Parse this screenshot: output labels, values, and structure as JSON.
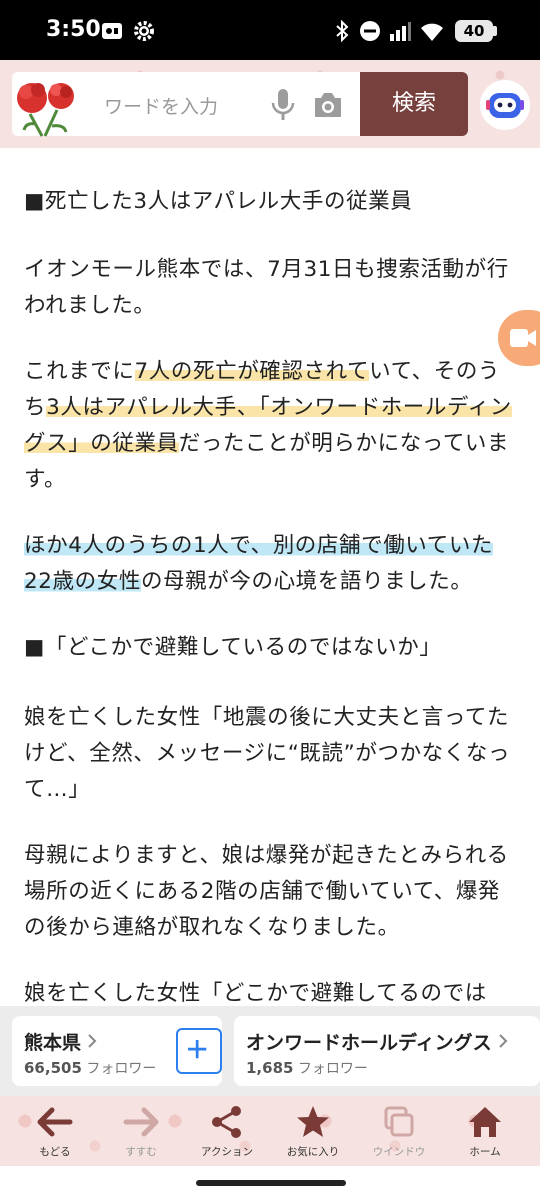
{
  "status_bar": {
    "time": "3:50",
    "battery": "40",
    "icons": [
      "screen-record-icon",
      "settings-gear-icon",
      "bluetooth-icon",
      "do-not-disturb-icon",
      "signal-icon",
      "wifi-icon",
      "battery-icon"
    ]
  },
  "header": {
    "search_placeholder": "ワードを入力",
    "search_button": "検索",
    "icons": [
      "carnation-flower-logo",
      "mic-icon",
      "camera-icon",
      "assistant-bot-icon"
    ]
  },
  "article": {
    "paragraphs": [
      [
        "■死亡した3人はアパレル大手の従業員"
      ],
      [
        "イオンモール熊本では、7月31日も捜索活動が行われました。"
      ],
      [
        "これまでに",
        "7人の死亡が確認されて",
        "いて、そのうち",
        "3人はアパレル大手、「オンワードホールディングス」の従業員",
        "だったことが明らかになっています。"
      ],
      [
        "ほか4人のうちの1人で、別の店舗で働いていた22歳の女性",
        "の母親が今の心境を語りました。"
      ],
      [
        "■「どこかで避難しているのではないか」"
      ],
      [
        "娘を亡くした女性「地震の後に大丈夫と言ってたけど、全然、メッセージに“既読”がつかなくなって…」"
      ],
      [
        "母親によりますと、娘は爆発が起きたとみられる場所の近くにある2階の店舗で働いていて、爆発の後から連絡が取れなくなりました。"
      ],
      [
        "娘を亡くした女性「どこかで避難してるのでは"
      ]
    ],
    "highlight_color_yellow": "#fbe4a8",
    "highlight_color_blue": "#bfe7f6"
  },
  "follow": [
    {
      "name": "熊本県",
      "count": "66,505",
      "unit": "フォロワー"
    },
    {
      "name": "オンワードホールディングス",
      "count": "1,685",
      "unit": "フォロワー"
    }
  ],
  "nav": [
    {
      "label": "もどる",
      "icon": "back-arrow-icon"
    },
    {
      "label": "すすむ",
      "icon": "forward-arrow-icon"
    },
    {
      "label": "アクション",
      "icon": "share-icon"
    },
    {
      "label": "お気に入り",
      "icon": "star-icon"
    },
    {
      "label": "ウインドウ",
      "icon": "window-icon"
    },
    {
      "label": "ホーム",
      "icon": "home-icon"
    }
  ],
  "colors": {
    "brand": "#76413d",
    "accent_blue": "#2d7ff0",
    "header_bg": "#f6e3e1"
  }
}
